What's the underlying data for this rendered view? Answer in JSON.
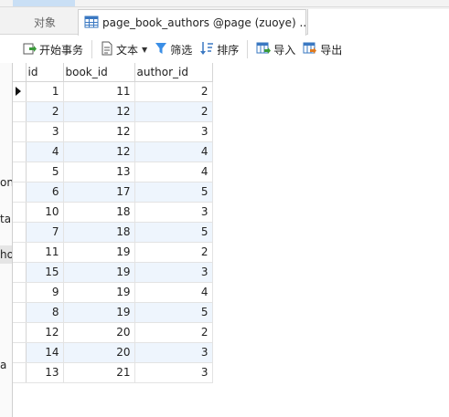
{
  "tabs": {
    "objects_label": "对象",
    "table_tab_label": "page_book_authors @page (zuoye) ..."
  },
  "toolbar": {
    "begin_transaction": "开始事务",
    "text": "文本",
    "filter": "筛选",
    "sort": "排序",
    "import": "导入",
    "export": "导出"
  },
  "left_panel": {
    "fragments": [
      "on",
      "tai",
      "ho",
      "a"
    ]
  },
  "grid": {
    "columns": [
      "id",
      "book_id",
      "author_id"
    ],
    "rows": [
      [
        "1",
        "11",
        "2"
      ],
      [
        "2",
        "12",
        "2"
      ],
      [
        "3",
        "12",
        "3"
      ],
      [
        "4",
        "12",
        "4"
      ],
      [
        "5",
        "13",
        "4"
      ],
      [
        "6",
        "17",
        "5"
      ],
      [
        "10",
        "18",
        "3"
      ],
      [
        "7",
        "18",
        "5"
      ],
      [
        "11",
        "19",
        "2"
      ],
      [
        "15",
        "19",
        "3"
      ],
      [
        "9",
        "19",
        "4"
      ],
      [
        "8",
        "19",
        "5"
      ],
      [
        "12",
        "20",
        "2"
      ],
      [
        "14",
        "20",
        "3"
      ],
      [
        "13",
        "21",
        "3"
      ]
    ]
  },
  "colors": {
    "alt_row": "#eef5fd",
    "active_menu": "#c9dff5",
    "grid_line": "#e3e3e3"
  }
}
